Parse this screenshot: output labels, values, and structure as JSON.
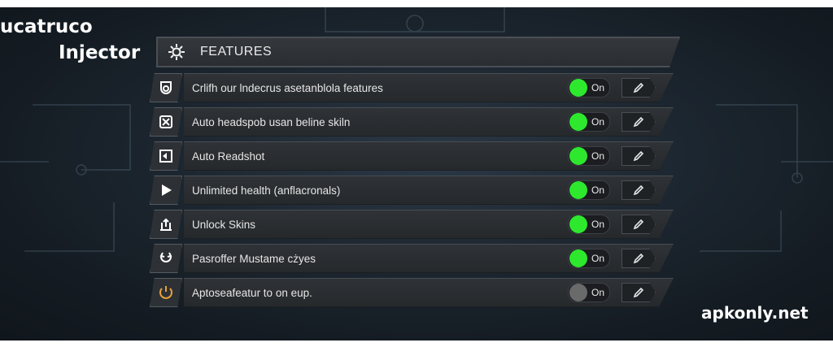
{
  "brand": {
    "line1": "ucatruco",
    "line2": "Injector"
  },
  "watermark": "apkonly.net",
  "header": {
    "title": "FEATURES",
    "icon": "gear-icon"
  },
  "features": [
    {
      "label": "Crlifh our lndecrus asetanblola features",
      "toggle": "On",
      "enabled": true,
      "icon": "shield-icon"
    },
    {
      "label": "Auto headspob usan beline skiln",
      "toggle": "On",
      "enabled": true,
      "icon": "crosshair-icon"
    },
    {
      "label": "Auto Readshot",
      "toggle": "On",
      "enabled": true,
      "icon": "target-icon"
    },
    {
      "label": "Unlimited health (anflacronals)",
      "toggle": "On",
      "enabled": true,
      "icon": "play-icon"
    },
    {
      "label": "Unlock Skins",
      "toggle": "On",
      "enabled": true,
      "icon": "unlock-icon"
    },
    {
      "label": "Pasroffer Mustame cżyes",
      "toggle": "On",
      "enabled": true,
      "icon": "refresh-icon"
    },
    {
      "label": "Aptoseafeatur to on eup.",
      "toggle": "On",
      "enabled": false,
      "icon": "power-icon"
    }
  ],
  "colors": {
    "on": "#2ee82e",
    "off": "#6a6a6a",
    "power_icon": "#e8a23a"
  }
}
